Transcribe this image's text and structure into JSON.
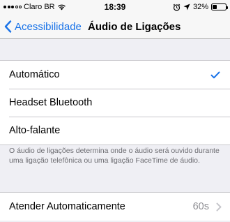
{
  "status_bar": {
    "carrier": "Claro BR",
    "time": "18:39",
    "battery_percent": "32%",
    "battery_level": 0.32
  },
  "nav": {
    "back_label": "Acessibilidade",
    "title": "Áudio de Ligações"
  },
  "routing_options": [
    {
      "label": "Automático",
      "selected": true
    },
    {
      "label": "Headset Bluetooth",
      "selected": false
    },
    {
      "label": "Alto-falante",
      "selected": false
    }
  ],
  "footer": {
    "text": "O áudio de ligações determina onde o áudio será ouvido durante uma ligação telefônica ou uma ligação FaceTime de áudio."
  },
  "auto_answer": {
    "label": "Atender Automaticamente",
    "value": "60s"
  },
  "colors": {
    "accent": "#1a73e8",
    "background": "#efeff4",
    "secondary_text": "#6d6d72"
  }
}
